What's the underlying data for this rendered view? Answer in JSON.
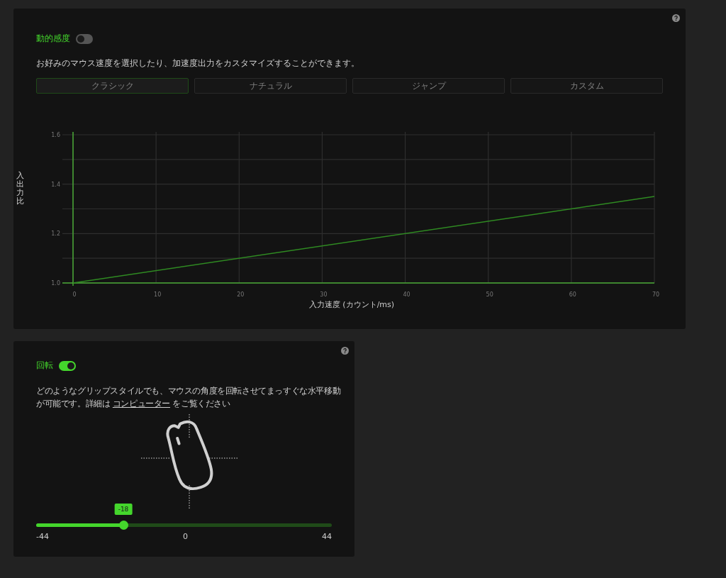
{
  "dynamic_sensitivity": {
    "label": "動的感度",
    "on": false,
    "description": "お好みのマウス速度を選択したり、加速度出力をカスタマイズすることができます。",
    "presets": [
      {
        "label": "クラシック",
        "selected": true
      },
      {
        "label": "ナチュラル",
        "selected": false
      },
      {
        "label": "ジャンプ",
        "selected": false
      },
      {
        "label": "カスタム",
        "selected": false
      }
    ],
    "chart_data": {
      "type": "line",
      "xlabel": "入力速度 (カウント/ms)",
      "ylabel": "入出力比",
      "x": [
        0,
        70
      ],
      "series": [
        {
          "color": "#2f8a22",
          "values": [
            1.0,
            1.35
          ]
        }
      ],
      "grid": true,
      "xlim": [
        0,
        70
      ],
      "ylim": [
        1.0,
        1.6
      ],
      "xticks": [
        0,
        10,
        20,
        30,
        40,
        50,
        60,
        70
      ],
      "yticks": [
        {
          "value": 1.0,
          "label": "1.0"
        },
        {
          "value": 1.2,
          "label": "1.2"
        },
        {
          "value": 1.4,
          "label": "1.4"
        },
        {
          "value": 1.6,
          "label": "1.6"
        }
      ]
    }
  },
  "rotation": {
    "label": "回転",
    "on": true,
    "description_before": "どのようなグリップスタイルでも、マウスの角度を回転させてまっすぐな水平移動が可能です。詳細は ",
    "link": "コンピューター",
    "description_after": " をご覧ください",
    "slider": {
      "level": 0.295,
      "value": "-18",
      "min": "-44",
      "mid": "0",
      "max": "44"
    }
  }
}
